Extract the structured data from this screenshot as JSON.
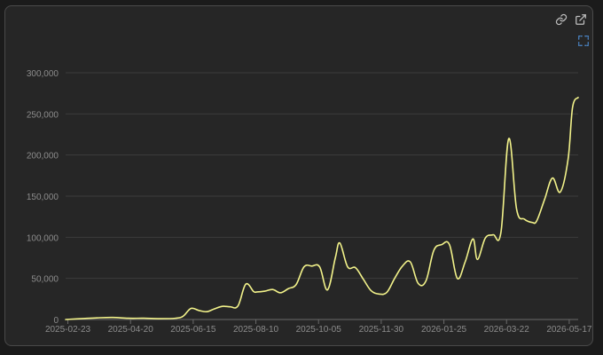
{
  "toolbar": {
    "link_icon": "link-icon",
    "open_external_icon": "open-external-icon",
    "reset_zoom_icon": "reset-zoom-icon"
  },
  "colors": {
    "background": "#262626",
    "grid": "#3c3c3c",
    "tick_text": "#8c8c8c",
    "line": "#f2f28a",
    "icon": "#bdbdbd",
    "accent_icon": "#4f8fd6"
  },
  "chart_data": {
    "type": "line",
    "title": "",
    "xlabel": "",
    "ylabel": "",
    "grid": true,
    "legend": "none",
    "ylim": [
      0,
      300000
    ],
    "xlim": [
      "2025-02-21",
      "2026-05-25"
    ],
    "yticks": [
      0,
      50000,
      100000,
      150000,
      200000,
      250000,
      300000
    ],
    "ytick_labels": [
      "0",
      "50,000",
      "100,000",
      "150,000",
      "200,000",
      "250,000",
      "300,000"
    ],
    "xticks": [
      "2025-02-23",
      "2025-04-20",
      "2025-06-15",
      "2025-08-10",
      "2025-10-05",
      "2025-11-30",
      "2026-01-25",
      "2026-03-22",
      "2026-05-17"
    ],
    "series": [
      {
        "x": [
          "2025-02-21",
          "2025-03-07",
          "2025-03-21",
          "2025-04-04",
          "2025-04-18",
          "2025-05-02",
          "2025-05-16",
          "2025-05-30",
          "2025-06-06",
          "2025-06-13",
          "2025-06-20",
          "2025-06-27",
          "2025-07-04",
          "2025-07-11",
          "2025-07-18",
          "2025-07-25",
          "2025-08-01",
          "2025-08-08",
          "2025-08-11",
          "2025-08-18",
          "2025-08-25",
          "2025-09-01",
          "2025-09-08",
          "2025-09-15",
          "2025-09-22",
          "2025-09-29",
          "2025-10-06",
          "2025-10-13",
          "2025-10-20",
          "2025-10-24",
          "2025-10-31",
          "2025-11-07",
          "2025-11-14",
          "2025-11-21",
          "2025-11-28",
          "2025-12-05",
          "2025-12-12",
          "2025-12-19",
          "2025-12-26",
          "2026-01-02",
          "2026-01-09",
          "2026-01-16",
          "2026-01-23",
          "2026-01-30",
          "2026-02-06",
          "2026-02-13",
          "2026-02-20",
          "2026-02-24",
          "2026-03-03",
          "2026-03-10",
          "2026-03-17",
          "2026-03-24",
          "2026-03-31",
          "2026-04-07",
          "2026-04-14",
          "2026-04-18",
          "2026-04-25",
          "2026-05-02",
          "2026-05-09",
          "2026-05-16",
          "2026-05-20",
          "2026-05-25"
        ],
        "y": [
          0,
          1000,
          2000,
          2500,
          1500,
          1500,
          1000,
          1500,
          4000,
          13500,
          11000,
          9500,
          13000,
          16000,
          15500,
          16500,
          43000,
          34000,
          33500,
          34500,
          36500,
          32500,
          37500,
          42500,
          64000,
          65000,
          64000,
          36000,
          75000,
          93000,
          64000,
          63000,
          49000,
          35000,
          31000,
          33000,
          50000,
          65000,
          70000,
          44000,
          47000,
          84000,
          91000,
          91000,
          50000,
          70000,
          98000,
          73000,
          99000,
          103000,
          106000,
          220000,
          134000,
          122000,
          118000,
          120000,
          146000,
          172000,
          155000,
          195000,
          258000,
          270000
        ]
      }
    ]
  }
}
